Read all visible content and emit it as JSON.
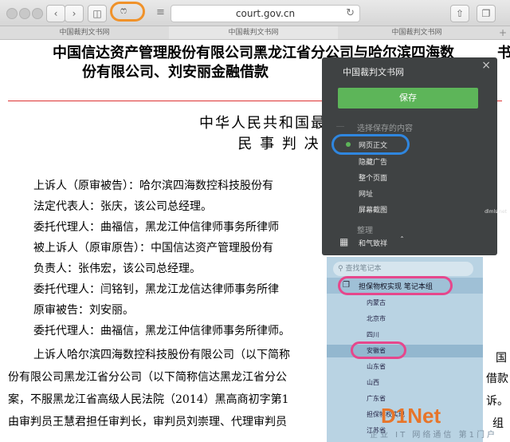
{
  "browser": {
    "address": "court.gov.cn",
    "extension_icon": "ෆ",
    "tabs": [
      "中国裁判文书网",
      "中国裁判文书网",
      "中国裁判文书网"
    ],
    "tab_plus": "+"
  },
  "document": {
    "title_line1": "中国信达资产管理股份有限公司黑龙江省分公司与哈尔滨四海数",
    "title_line1_right": "书",
    "title_line2": "份有限公司、刘安丽金融借款",
    "heading1": "中华人民共和国最",
    "heading2": "民 事 判 决",
    "paragraphs": [
      "上诉人（原审被告）：哈尔滨四海数控科技股份有",
      "法定代表人：张庆，该公司总经理。",
      "委托代理人：曲福信，黑龙江仲信律师事务所律师",
      "被上诉人（原审原告）：中国信达资产管理股份有",
      "负责人：张伟宏，该公司总经理。",
      "委托代理人：闫铭钊，黑龙江龙信达律师事务所律",
      "原审被告：刘安丽。",
      "委托代理人：曲福信，黑龙江仲信律师事务所律师。",
      "上诉人哈尔滨四海数控科技股份有限公司（以下简称",
      "份有限公司黑龙江省分公司（以下简称信达黑龙江省分公",
      "案，不服黑龙江省高级人民法院（2014）黑高商初字第1",
      "由审判员王慧君担任审判长，审判员刘崇理、代理审判员"
    ],
    "right_fragments": [
      "国",
      "借款",
      "诉。",
      "组"
    ]
  },
  "clipper": {
    "title": "中国裁判文书网",
    "save_label": "保存",
    "section_content": "选择保存的内容",
    "options": [
      "网页正文",
      "隐藏广告",
      "整个页面",
      "网址",
      "屏幕截图"
    ],
    "section_organize": "整理",
    "user_label": "和气致祥",
    "search_placeholder": "查找笔记本",
    "notebook_label": "担保物权实现 笔记本组",
    "notebooks": [
      "内蒙古",
      "北京市",
      "四川",
      "安徽省",
      "山东省",
      "山西",
      "广东省",
      "担保物权实现",
      "江苏省"
    ]
  },
  "watermark": "dlmls.net",
  "logo": {
    "text": "D1Net",
    "subtitle": "企业 IT 网络通信 第1门户"
  },
  "colors": {
    "save_green": "#5db559",
    "annotation_orange": "#f0922a",
    "annotation_blue": "#2f86df",
    "annotation_pink": "#e6478c"
  }
}
